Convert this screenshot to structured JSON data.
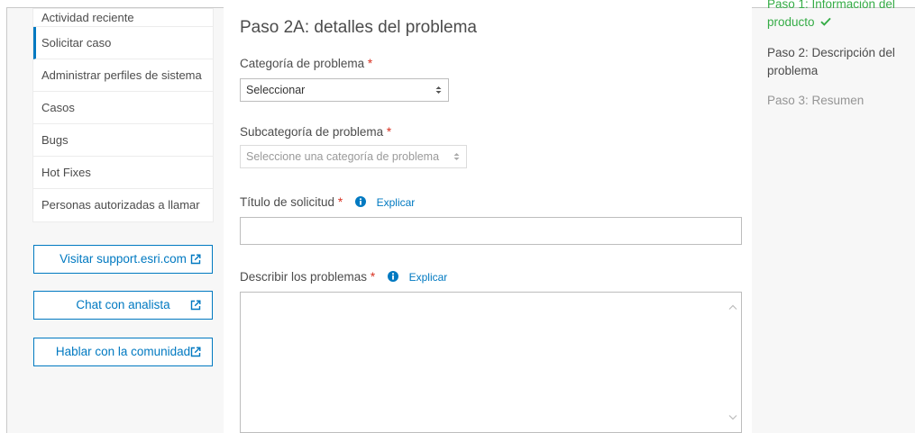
{
  "sidebar": {
    "items": [
      {
        "label": "Actividad reciente",
        "active": false
      },
      {
        "label": "Solicitar caso",
        "active": true
      },
      {
        "label": "Administrar perfiles de sistema",
        "active": false
      },
      {
        "label": "Casos",
        "active": false
      },
      {
        "label": "Bugs",
        "active": false
      },
      {
        "label": "Hot Fixes",
        "active": false
      },
      {
        "label": "Personas autorizadas a llamar",
        "active": false
      }
    ],
    "buttons": [
      {
        "label": "Visitar support.esri.com",
        "icon": "external-link-icon"
      },
      {
        "label": "Chat con analista",
        "icon": "external-link-icon"
      },
      {
        "label": "Hablar con la comunidad",
        "icon": "external-link-icon"
      }
    ]
  },
  "form": {
    "title": "Paso 2A: detalles del problema",
    "required_mark": "*",
    "category": {
      "label": "Categoría de problema",
      "value": "Seleccionar"
    },
    "subcategory": {
      "label": "Subcategoría de problema",
      "value": "Seleccione una categoría de problema"
    },
    "request_title": {
      "label": "Título de solicitud",
      "explain": "Explicar",
      "value": ""
    },
    "describe": {
      "label": "Describir los problemas",
      "explain": "Explicar",
      "value": ""
    }
  },
  "steps": {
    "step1_line1": "Paso 1: Información del",
    "step1_line2": "producto",
    "step2_line1": "Paso 2: Descripción del",
    "step2_line2": "problema",
    "step3": "Paso 3: Resumen"
  },
  "colors": {
    "accent": "#0079c1",
    "required": "#d83020",
    "done": "#35ac46"
  }
}
